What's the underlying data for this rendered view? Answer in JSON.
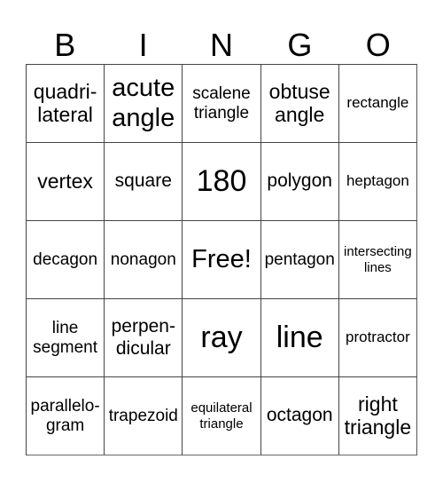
{
  "header": {
    "letters": [
      "B",
      "I",
      "N",
      "G",
      "O"
    ]
  },
  "board": {
    "rows": [
      [
        "quadri-\nlateral",
        "acute\nangle",
        "scalene\ntriangle",
        "obtuse\nangle",
        "rectangle"
      ],
      [
        "vertex",
        "square",
        "180",
        "polygon",
        "heptagon"
      ],
      [
        "decagon",
        "nonagon",
        "Free!",
        "pentagon",
        "intersecting\nlines"
      ],
      [
        "line\nsegment",
        "perpen-\ndicular",
        "ray",
        "line",
        "protractor"
      ],
      [
        "parallelo-\ngram",
        "trapezoid",
        "equilateral\ntriangle",
        "octagon",
        "right\ntriangle"
      ]
    ]
  }
}
